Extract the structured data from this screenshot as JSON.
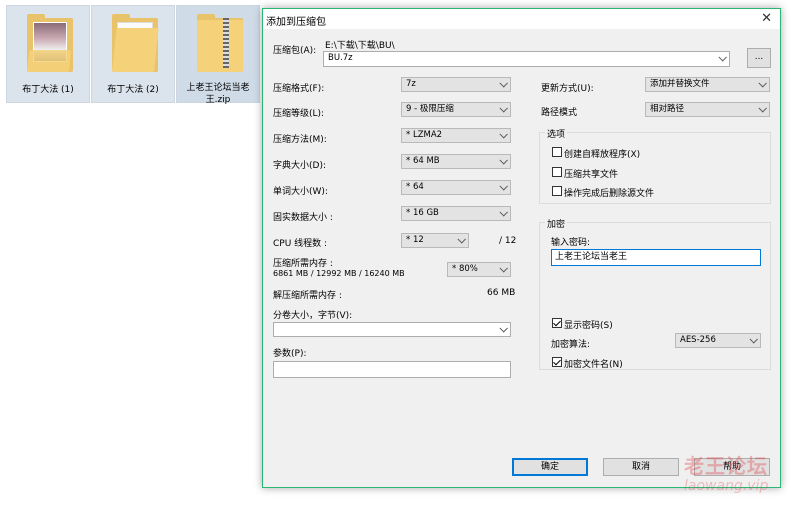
{
  "desktop": {
    "files": [
      {
        "label": "布丁大法 (1)",
        "icon": "photo-folder-icon"
      },
      {
        "label": "布丁大法 (2)",
        "icon": "folder-icon"
      },
      {
        "label": "上老王论坛当老王.zip",
        "label_line1": "上老王论坛当老",
        "label_line2": "王.zip",
        "icon": "zip-folder-icon"
      }
    ]
  },
  "dialog": {
    "title": "添加到压缩包",
    "archive_label": "压缩包(A):",
    "archive_path": "E:\\下载\\下载\\BU\\",
    "archive_name": "BU.7z",
    "browse_label": "...",
    "left": {
      "format_label": "压缩格式(F):",
      "format_value": "7z",
      "level_label": "压缩等级(L):",
      "level_value": "9 - 极限压缩",
      "method_label": "压缩方法(M):",
      "method_value": "* LZMA2",
      "dict_label": "字典大小(D):",
      "dict_value": "* 64 MB",
      "word_label": "单词大小(W):",
      "word_value": "* 64",
      "solid_label": "固实数据大小 :",
      "solid_value": "* 16 GB",
      "cpu_label": "CPU 线程数 :",
      "cpu_value": "* 12",
      "cpu_max": "/ 12",
      "mem_comp_label": "压缩所需内存 :",
      "mem_comp_detail": "6861 MB / 12992 MB / 16240 MB",
      "mem_comp_value": "* 80%",
      "mem_decomp_label": "解压缩所需内存 :",
      "mem_decomp_value": "66 MB",
      "split_label": "分卷大小，字节(V):",
      "split_value": "",
      "params_label": "参数(P):",
      "params_value": ""
    },
    "right": {
      "update_label": "更新方式(U):",
      "update_value": "添加并替换文件",
      "path_label": "路径模式",
      "path_value": "相对路径",
      "options_title": "选项",
      "opt_sfx": "创建自释放程序(X)",
      "opt_sfx_checked": false,
      "opt_shared": "压缩共享文件",
      "opt_shared_checked": false,
      "opt_delete": "操作完成后删除源文件",
      "opt_delete_checked": false,
      "encrypt_title": "加密",
      "password_label": "输入密码:",
      "password_value": "上老王论坛当老王",
      "show_password": "显示密码(S)",
      "show_password_checked": true,
      "enc_method_label": "加密算法:",
      "enc_method_value": "AES-256",
      "enc_names": "加密文件名(N)",
      "enc_names_checked": true
    },
    "buttons": {
      "ok": "确定",
      "cancel": "取消",
      "help": "帮助"
    }
  },
  "watermark": {
    "line1": "老王论坛",
    "line2": "laowang.vip"
  },
  "colors": {
    "accent_border": "#2bb673",
    "default_button": "#0078d7",
    "folder": "#e8c36a"
  }
}
